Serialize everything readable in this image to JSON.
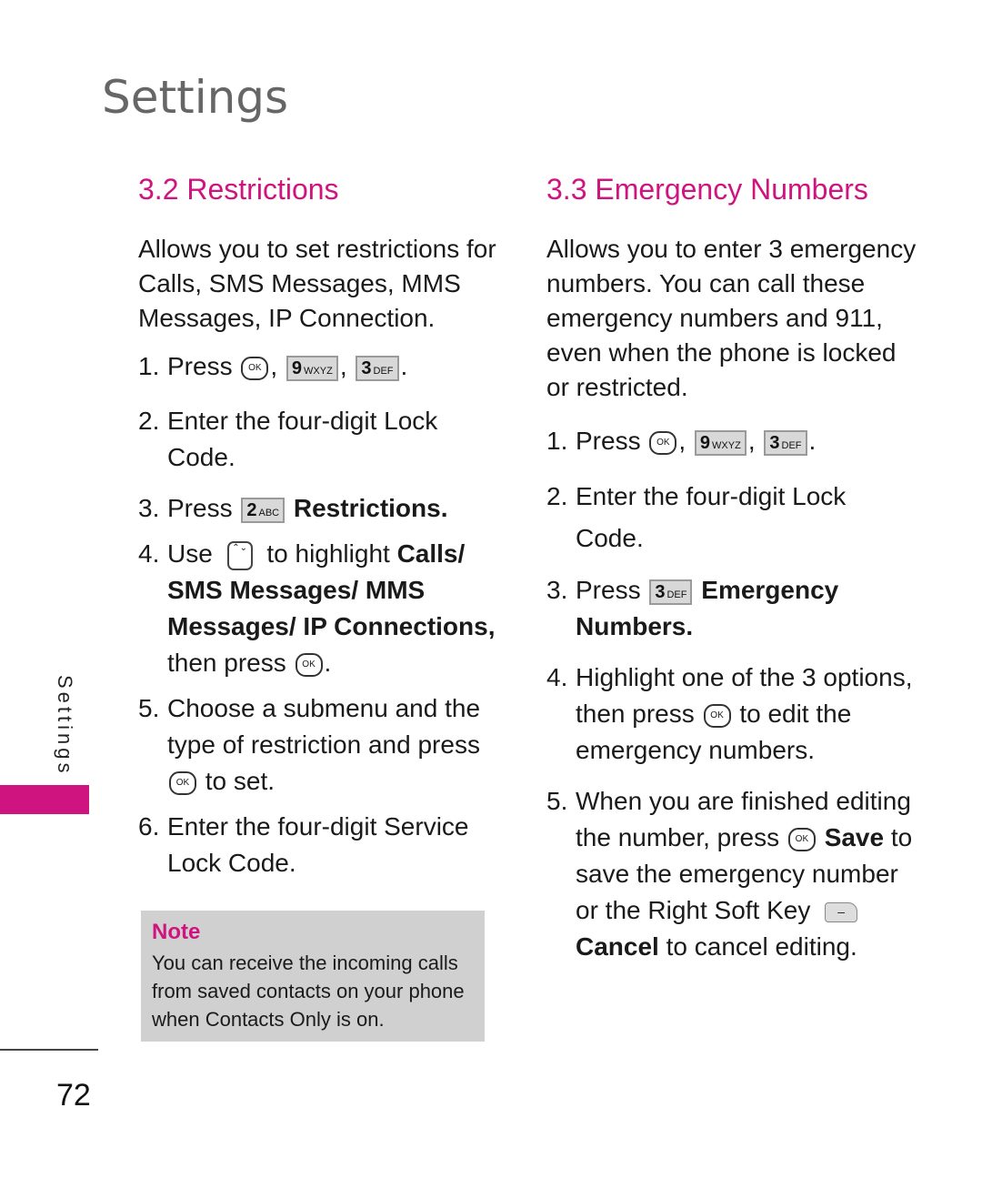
{
  "page": {
    "title": "Settings",
    "side_label": "Settings",
    "page_number": "72"
  },
  "brand_color": "#d0147f",
  "left": {
    "title": "3.2 Restrictions",
    "description": "Allows you to set restrictions for Calls, SMS Messages, MMS Messages, IP Connection.",
    "steps": {
      "s1": {
        "num": "1.",
        "pre": "Press"
      },
      "s2": {
        "num": "2.",
        "text": "Enter the four-digit Lock Code."
      },
      "s3": {
        "num": "3.",
        "pre": "Press",
        "bold": "Restrictions."
      },
      "s4": {
        "num": "4.",
        "pre": "Use",
        "mid": "to highlight",
        "bold": "Calls/ SMS Messages/ MMS Messages/ IP Connections,",
        "post": "then press"
      },
      "s5": {
        "num": "5.",
        "text": "Choose a submenu and the type of restriction and press",
        "post": "to set."
      },
      "s6": {
        "num": "6.",
        "text": "Enter the four-digit Service Lock Code."
      }
    },
    "note": {
      "title": "Note",
      "text": "You can receive the incoming calls from saved contacts on your phone when Contacts Only is on."
    }
  },
  "right": {
    "title": "3.3 Emergency Numbers",
    "description": "Allows you to enter 3 emergency numbers. You can call these emergency numbers and 911, even when the phone is locked or restricted.",
    "steps": {
      "s1": {
        "num": "1.",
        "pre": "Press"
      },
      "s2": {
        "num": "2.",
        "text": "Enter the four-digit Lock Code."
      },
      "s3": {
        "num": "3.",
        "pre": "Press",
        "bold": "Emergency Numbers."
      },
      "s4": {
        "num": "4.",
        "pre": "Highlight one of the 3 options, then press",
        "post": "to edit the emergency numbers."
      },
      "s5": {
        "num": "5.",
        "pre": "When you are finished editing the number, press",
        "bold1": "Save",
        "mid": "to save the emergency number or the Right Soft Key",
        "bold2": "Cancel",
        "post": "to cancel editing."
      }
    }
  },
  "keys": {
    "ok": "OK",
    "k9": "9",
    "k9sub": "WXYZ",
    "k3": "3",
    "k3sub": "DEF",
    "k2": "2",
    "k2sub": "ABC",
    "nav": "⌃⌄",
    "softkey": "–"
  }
}
